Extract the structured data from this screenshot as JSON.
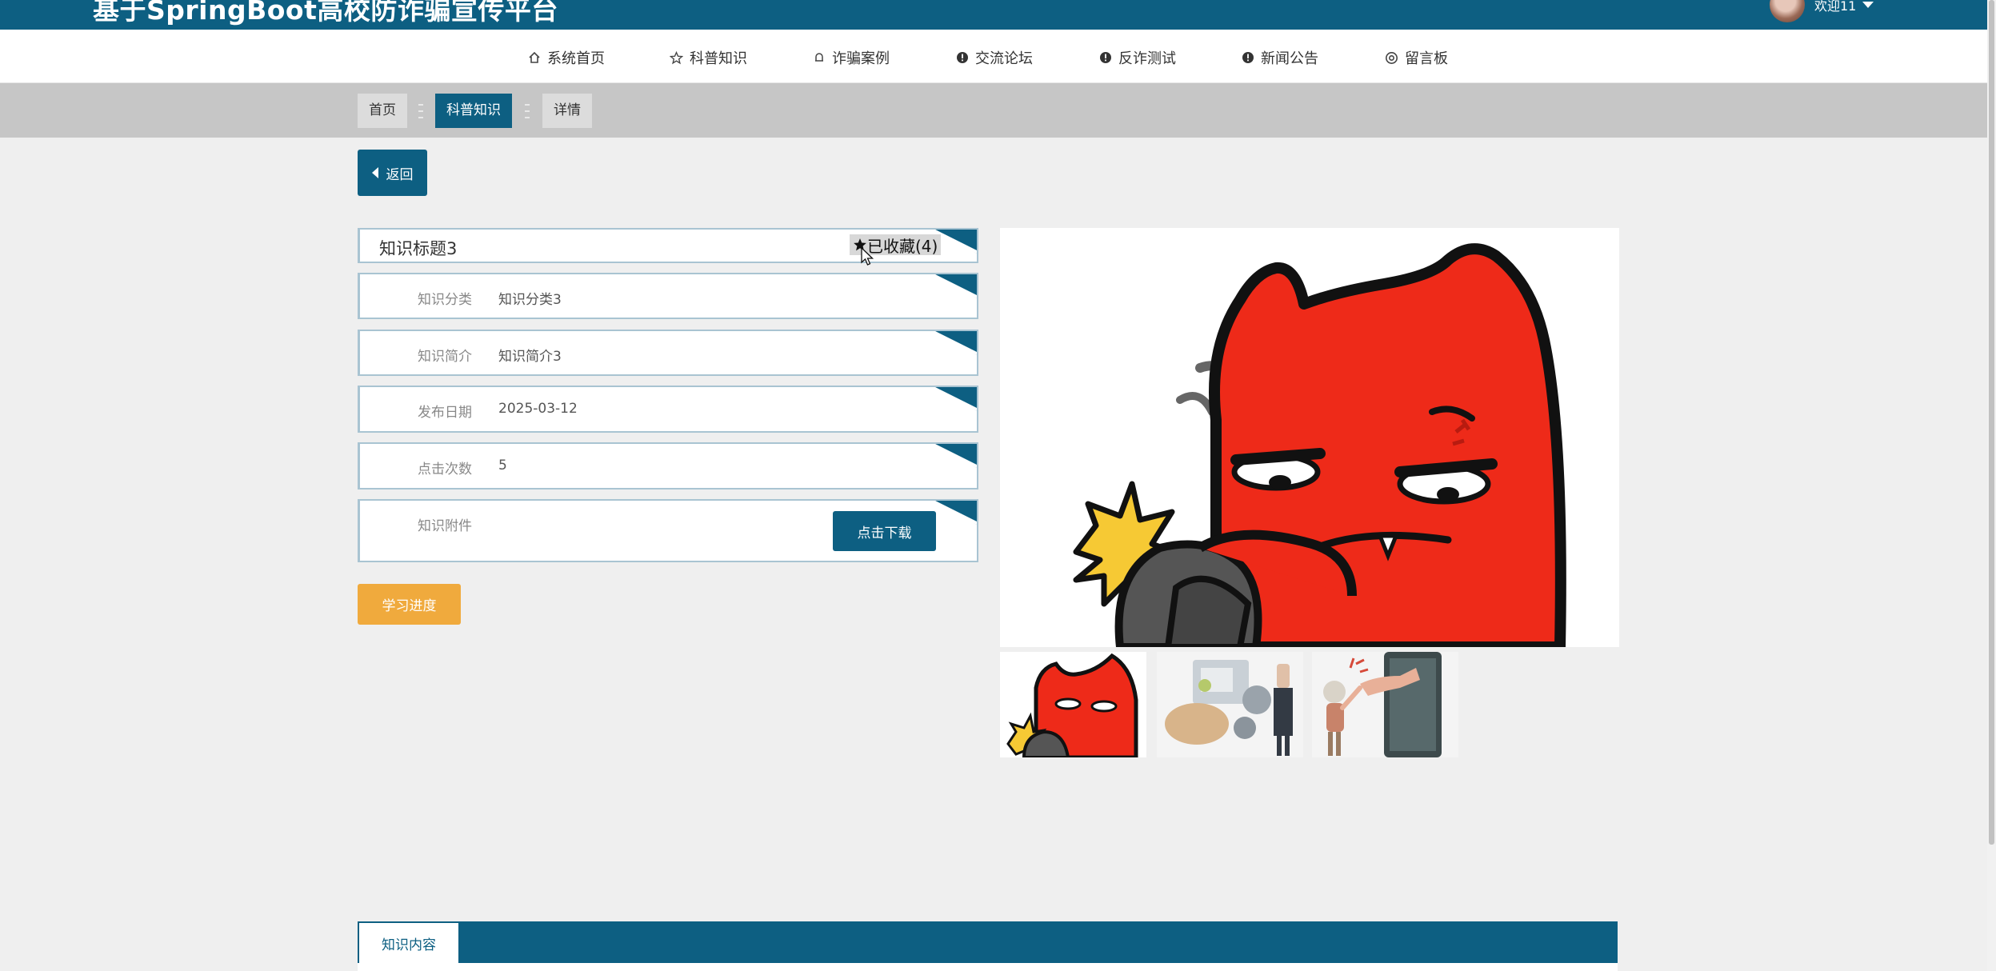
{
  "header": {
    "brand": "基于SpringBoot高校防诈骗宣传平台",
    "user_label": "欢迎11"
  },
  "nav": [
    {
      "icon": "home-icon",
      "label": "系统首页"
    },
    {
      "icon": "star-outline-icon",
      "label": "科普知识"
    },
    {
      "icon": "bell-icon",
      "label": "诈骗案例"
    },
    {
      "icon": "info-circle-icon",
      "label": "交流论坛"
    },
    {
      "icon": "info-circle-icon",
      "label": "反诈测试"
    },
    {
      "icon": "info-circle-icon",
      "label": "新闻公告"
    },
    {
      "icon": "settings-icon",
      "label": "留言板"
    }
  ],
  "breadcrumb": [
    "首页",
    "科普知识",
    "详情"
  ],
  "back_label": "返回",
  "detail": {
    "title": "知识标题3",
    "favorite_label": "已收藏(4)",
    "fields": [
      {
        "label": "知识分类",
        "value": "知识分类3"
      },
      {
        "label": "知识简介",
        "value": "知识简介3"
      },
      {
        "label": "发布日期",
        "value": "2025-03-12"
      },
      {
        "label": "点击次数",
        "value": "5"
      }
    ],
    "attachment_label": "知识附件",
    "download_label": "点击下载"
  },
  "study_label": "学习进度",
  "tabs": {
    "content_tab": "知识内容"
  },
  "colors": {
    "primary": "#0d5f82",
    "accent": "#f0aa3d",
    "page_bg": "#efefef",
    "crumb_bg": "#c6c6c6"
  }
}
